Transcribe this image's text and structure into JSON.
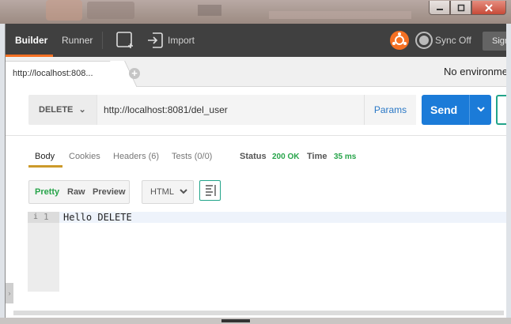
{
  "window": {
    "minimize_icon": "minimize-icon",
    "maximize_icon": "maximize-icon",
    "close_icon": "close-icon"
  },
  "toolbar": {
    "builder_label": "Builder",
    "runner_label": "Runner",
    "import_label": "Import",
    "sync_label": "Sync Off",
    "signin_label": "Sign",
    "accent_color": "#f47023"
  },
  "tabs": {
    "request_tab_label": "http://localhost:808...",
    "add_tab_glyph": "+",
    "environment_label": "No environme"
  },
  "request": {
    "method": "DELETE",
    "url": "http://localhost:8081/del_user",
    "params_label": "Params",
    "send_label": "Send",
    "send_color": "#1b7bd8"
  },
  "response": {
    "tabs": [
      "Body",
      "Cookies",
      "Headers (6)",
      "Tests (0/0)"
    ],
    "active_tab": "Body",
    "status_label": "Status",
    "status_value": "200 OK",
    "time_label": "Time",
    "time_value": "35 ms",
    "status_color": "#27a44a",
    "formats": [
      "Pretty",
      "Raw",
      "Preview"
    ],
    "active_format": "Pretty",
    "language": "HTML",
    "body_lines": [
      {
        "number": "1",
        "fold": "i",
        "text": "Hello DELETE"
      }
    ]
  }
}
